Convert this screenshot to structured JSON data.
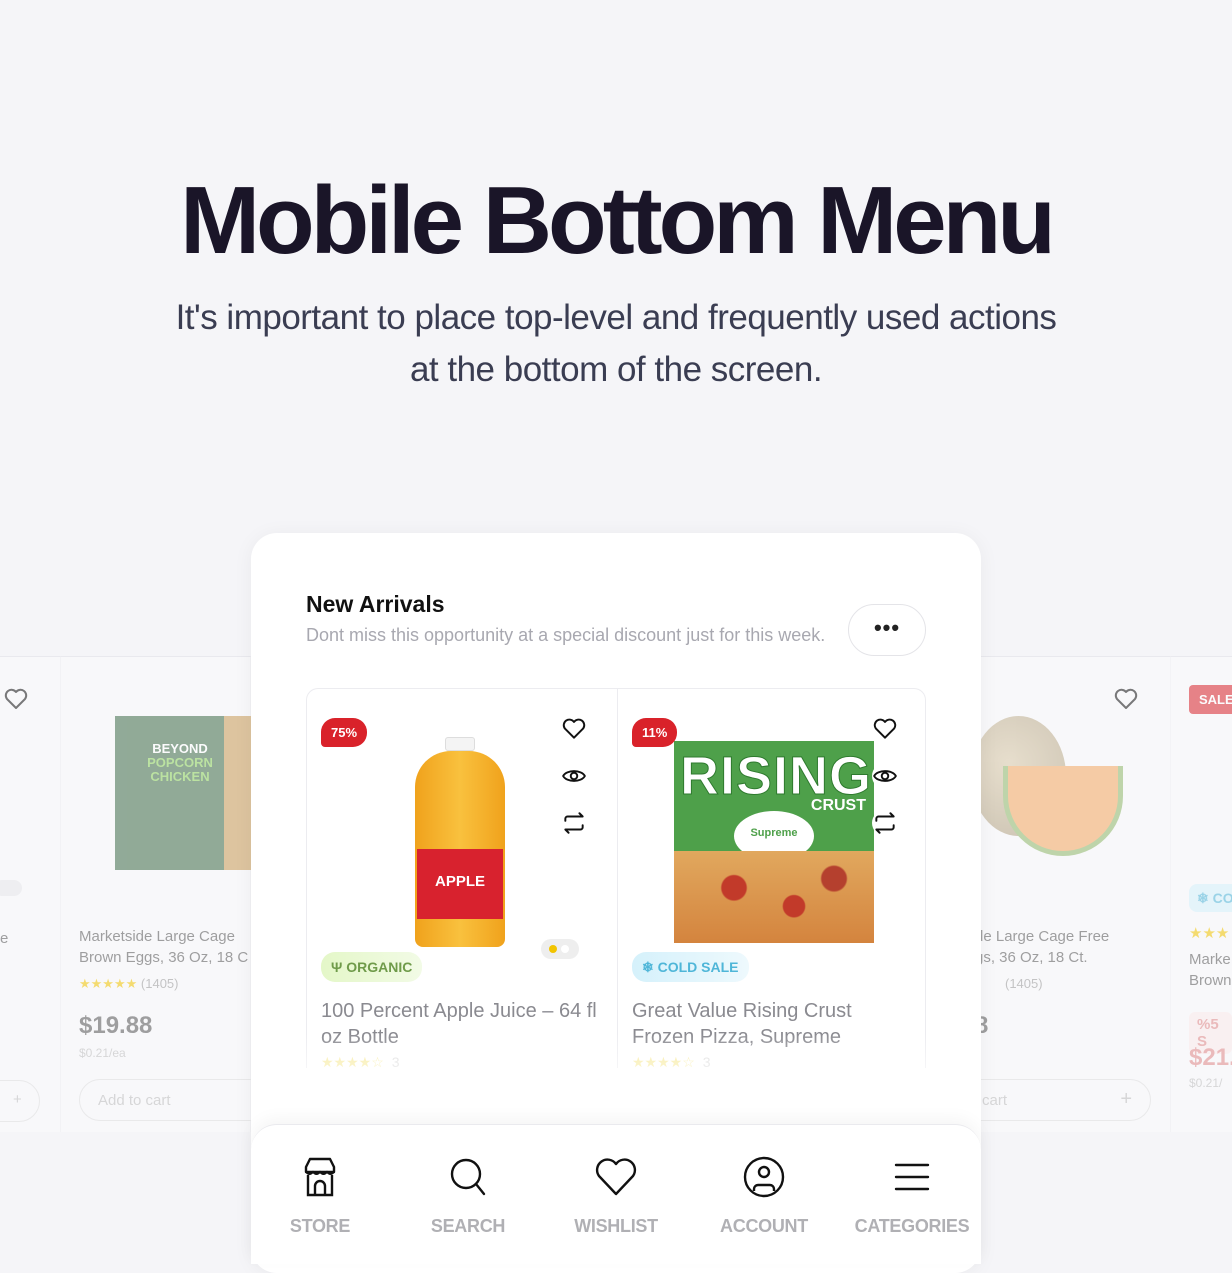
{
  "hero": {
    "title": "Mobile Bottom Menu",
    "subtitle_line1": "It's important to place top-level and frequently used actions",
    "subtitle_line2": "at the bottom of the screen."
  },
  "section": {
    "title": "New Arrivals",
    "subtitle": "Dont miss this opportunity at a special discount just for this week.",
    "more_label": "•••"
  },
  "products": [
    {
      "discount": "75%",
      "tag": "ORGANIC",
      "tag_icon": "sprout-icon",
      "title": "100 Percent Apple Juice – 64 fl oz Bottle",
      "stars": "★★★★☆",
      "rating_count": "3",
      "image": "apple-juice-bottle"
    },
    {
      "discount": "11%",
      "tag": "COLD SALE",
      "tag_icon": "snowflake-icon",
      "title": "Great Value Rising Crust Frozen Pizza, Supreme",
      "stars": "★★★★☆",
      "rating_count": "3",
      "image": "rising-crust-pizza-box"
    }
  ],
  "background_cards": {
    "left": {
      "title_line1": "Marketside Large Cage",
      "title_line2": "Brown Eggs, 36 Oz, 18 C",
      "stars": "★★★★★",
      "rating_count": "(1405)",
      "price": "$19.88",
      "unit_price": "$0.21/ea",
      "cart_label": "Add to cart",
      "partial_text": "e",
      "image": "beyond-popcorn-chicken"
    },
    "right": {
      "title_line1": "de Large Cage Free",
      "title_line2": "gs, 36 Oz, 18 Ct.",
      "rating_count": "(1405)",
      "price_partial": "8",
      "cart_label": "cart",
      "image": "cantaloupe"
    },
    "far_right": {
      "badge": "SALE",
      "tag": "CO",
      "title_line1": "Marke",
      "title_line2": "Brown",
      "discount": "%5 S",
      "price": "$21.",
      "unit_price": "$0.21/"
    }
  },
  "bottom_nav": [
    {
      "label": "STORE",
      "icon": "store-icon"
    },
    {
      "label": "SEARCH",
      "icon": "search-icon"
    },
    {
      "label": "WISHLIST",
      "icon": "heart-icon"
    },
    {
      "label": "ACCOUNT",
      "icon": "account-icon"
    },
    {
      "label": "CATEGORIES",
      "icon": "menu-icon"
    }
  ],
  "colors": {
    "discount_red": "#d9222a",
    "organic_green": "#6f9b4a",
    "cold_blue": "#4fb6d8",
    "nav_label": "#b0b0b4",
    "title_dark": "#1a1528"
  }
}
